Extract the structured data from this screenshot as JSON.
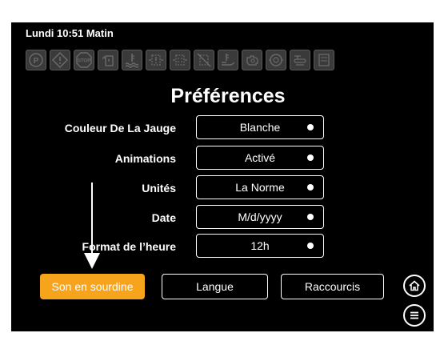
{
  "status": {
    "datetime": "Lundi 10:51 Matin"
  },
  "tell_tales": [
    {
      "icon": "parking-brake-icon"
    },
    {
      "icon": "warning-icon"
    },
    {
      "icon": "stop-icon"
    },
    {
      "icon": "fuel-water-icon"
    },
    {
      "icon": "coolant-temperature-icon"
    },
    {
      "icon": "dpf-regen-icon"
    },
    {
      "icon": "dpf-icon"
    },
    {
      "icon": "regen-inhibit-icon"
    },
    {
      "icon": "exhaust-temperature-icon"
    },
    {
      "icon": "engine-icon"
    },
    {
      "icon": "engine-oil-icon"
    },
    {
      "icon": "glow-plug-icon"
    },
    {
      "icon": "def-icon"
    }
  ],
  "page": {
    "title": "Préférences"
  },
  "preferences": [
    {
      "label": "Couleur De La Jauge",
      "value": "Blanche"
    },
    {
      "label": "Animations",
      "value": "Activé"
    },
    {
      "label": "Unités",
      "value": "La Norme"
    },
    {
      "label": "Date",
      "value": "M/d/yyyy"
    },
    {
      "label": "Format de l’heure",
      "value": "12h"
    }
  ],
  "buttons": {
    "mute": "Son en sourdine",
    "language": "Langue",
    "shortcuts": "Raccourcis"
  },
  "colors": {
    "accent": "#f7a41d",
    "screen_bg": "#000000",
    "text": "#ffffff",
    "tell_tale_inactive": "#6a6a6a"
  },
  "icons": {
    "home": "home-icon",
    "menu": "menu-icon"
  }
}
